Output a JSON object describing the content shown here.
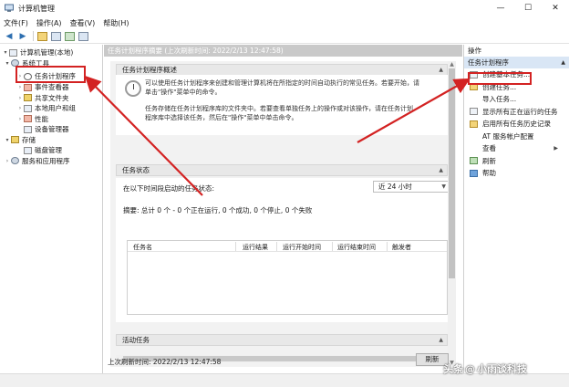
{
  "window": {
    "title": "计算机管理",
    "controls": {
      "minimize": "—",
      "maximize": "☐",
      "close": "✕"
    }
  },
  "menu": [
    "文件(F)",
    "操作(A)",
    "查看(V)",
    "帮助(H)"
  ],
  "tree": [
    {
      "label": "计算机管理(本地)",
      "toggle": "▾",
      "icon": "computer-management-icon"
    },
    {
      "label": "系统工具",
      "toggle": "▾",
      "icon": "tools-icon"
    },
    {
      "label": "任务计划程序",
      "toggle": "›",
      "icon": "clock-icon",
      "selected": true
    },
    {
      "label": "事件查看器",
      "toggle": "›",
      "icon": "event-viewer-icon"
    },
    {
      "label": "共享文件夹",
      "toggle": "›",
      "icon": "shared-folder-icon"
    },
    {
      "label": "本地用户和组",
      "toggle": "›",
      "icon": "users-icon"
    },
    {
      "label": "性能",
      "toggle": "›",
      "icon": "performance-icon"
    },
    {
      "label": "设备管理器",
      "toggle": "",
      "icon": "device-manager-icon"
    },
    {
      "label": "存储",
      "toggle": "▾",
      "icon": "storage-icon"
    },
    {
      "label": "磁盘管理",
      "toggle": "",
      "icon": "disk-icon"
    },
    {
      "label": "服务和应用程序",
      "toggle": "›",
      "icon": "services-icon"
    }
  ],
  "middle": {
    "header": "任务计划程序摘要 (上次刷新时间: 2022/2/13 12:47:58)",
    "overview_title": "任务计划程序概述",
    "overview_p1_l1": "可以使用任务计划程序来创建和管理计算机将在所指定的时间自动执行的常见任务。若要开始，请",
    "overview_p1_l2": "单击\"操作\"菜单中的命令。",
    "overview_p2_l1": "任务存储在任务计划程序库的文件夹中。若要查看单独任务上的操作或对该操作，请在任务计划",
    "overview_p2_l2": "程序库中选择该任务，然后在\"操作\"菜单中单击命令。",
    "status_title": "任务状态",
    "status_label": "在以下时间段启动的任务状态:",
    "status_period": "近 24 小时",
    "status_summary": "摘要: 总计 0 个 - 0 个正在运行, 0 个成功, 0 个停止, 0 个失败",
    "table_columns": [
      "任务名",
      "运行结果",
      "运行开始时间",
      "运行结束时间",
      "触发者"
    ],
    "active_title": "活动任务",
    "footer": "上次刷新时间: 2022/2/13 12:47:58",
    "refresh_button": "刷新"
  },
  "actions": {
    "header": "操作",
    "section": "任务计划程序",
    "items": [
      {
        "label": "创建基本任务...",
        "icon": "create-basic-task-icon"
      },
      {
        "label": "创建任务...",
        "icon": "create-task-icon"
      },
      {
        "label": "导入任务...",
        "icon": "none"
      },
      {
        "label": "显示所有正在运行的任务",
        "icon": "running-tasks-icon"
      },
      {
        "label": "启用所有任务历史记录",
        "icon": "history-icon"
      },
      {
        "label": "AT 服务帐户配置",
        "icon": "none"
      },
      {
        "label": "查看",
        "icon": "none",
        "submenu": true
      },
      {
        "label": "刷新",
        "icon": "refresh-icon"
      },
      {
        "label": "帮助",
        "icon": "help-icon"
      }
    ]
  },
  "watermark": {
    "prefix": "头条",
    "at": "@",
    "name": "小雨谈科技"
  },
  "colors": {
    "highlight": "#d32222",
    "action_section_bg": "#d9e6f5",
    "header_gray": "#c9c9c9"
  }
}
